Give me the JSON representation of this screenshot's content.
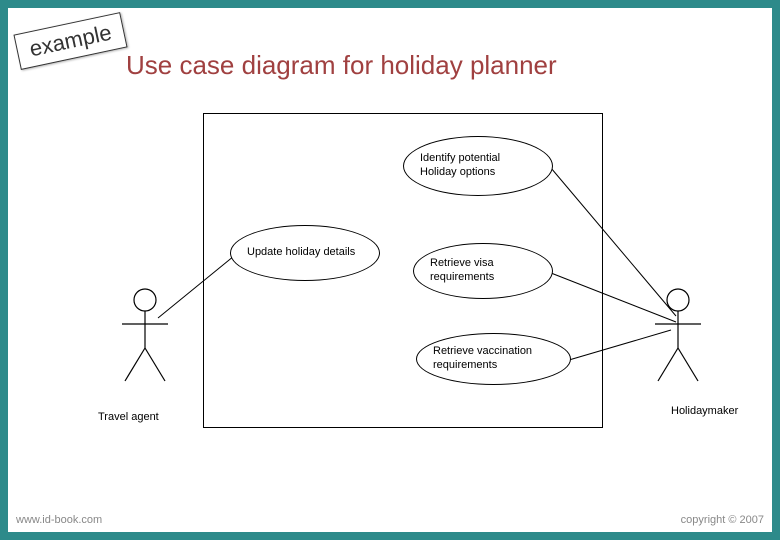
{
  "badge": "example",
  "title": "Use case diagram for holiday planner",
  "usecases": {
    "identify": "Identify potential\nHoliday options",
    "update": "Update holiday\ndetails",
    "visa": "Retrieve visa\nrequirements",
    "vaccination": "Retrieve vaccination\nrequirements"
  },
  "actors": {
    "left": "Travel agent",
    "right": "Holidaymaker"
  },
  "footer": {
    "left": "www.id-book.com",
    "right": "copyright © 2007"
  }
}
